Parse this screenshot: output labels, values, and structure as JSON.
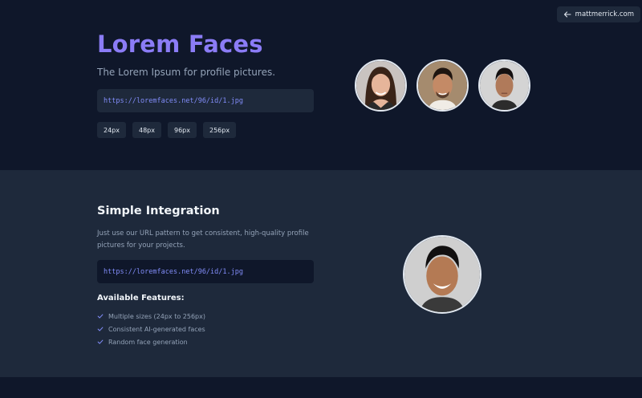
{
  "nav": {
    "back_link": "mattmerrick.com"
  },
  "hero": {
    "title": "Lorem Faces",
    "subtitle": "The Lorem Ipsum for profile pictures.",
    "url_example": "https://loremfaces.net/96/id/1.jpg",
    "sizes": [
      "24px",
      "48px",
      "96px",
      "256px"
    ]
  },
  "integration": {
    "title": "Simple Integration",
    "description": "Just use our URL pattern to get consistent, high-quality profile pictures for your projects.",
    "url_example": "https://loremfaces.net/96/id/1.jpg",
    "features_title": "Available Features:",
    "features": [
      "Multiple sizes (24px to 256px)",
      "Consistent AI-generated faces",
      "Random face generation"
    ]
  },
  "colors": {
    "background": "#0f172a",
    "section_background": "#1e293b",
    "accent": "#8b7cf6",
    "code_text": "#818cf8",
    "check": "#818cf8"
  }
}
